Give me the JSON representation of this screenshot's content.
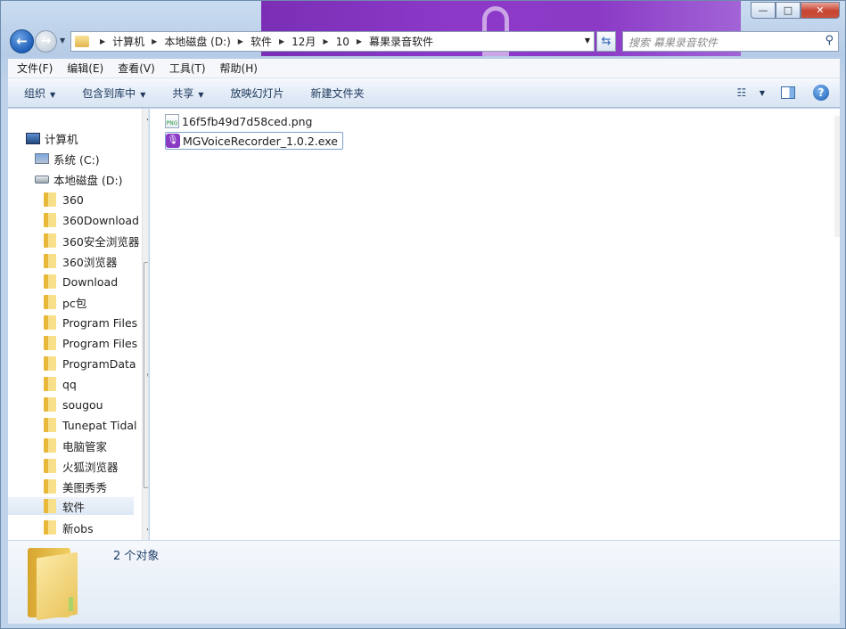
{
  "window": {
    "caption": {
      "minimize": "—",
      "maximize": "□",
      "close": "✕"
    }
  },
  "nav": {
    "back_glyph": "←",
    "forward_glyph": "→",
    "breadcrumbs": [
      "计算机",
      "本地磁盘 (D:)",
      "软件",
      "12月",
      "10",
      "幕果录音软件"
    ],
    "search_placeholder": "搜索 幕果录音软件"
  },
  "menubar": {
    "items": [
      "文件(F)",
      "编辑(E)",
      "查看(V)",
      "工具(T)",
      "帮助(H)"
    ]
  },
  "toolbar": {
    "organize": "组织",
    "include_in_library": "包含到库中",
    "share": "共享",
    "slideshow": "放映幻灯片",
    "new_folder": "新建文件夹"
  },
  "navpane": {
    "computer": "计算机",
    "drive_c": "系统 (C:)",
    "drive_d": "本地磁盘 (D:)",
    "folders": [
      "360",
      "360Download",
      "360安全浏览器",
      "360浏览器",
      "Download",
      "pc包",
      "Program Files",
      "Program Files",
      "ProgramData",
      "qq",
      "sougou",
      "Tunepat Tidal",
      "电脑管家",
      "火狐浏览器",
      "美图秀秀",
      "软件",
      "新obs"
    ],
    "selected_folder": "软件"
  },
  "files": [
    {
      "name": "16f5fb49d7d58ced.png",
      "type": "png",
      "selected": false
    },
    {
      "name": "MGVoiceRecorder_1.0.2.exe",
      "type": "exe",
      "selected": true
    }
  ],
  "details": {
    "count": "2 个对象"
  },
  "colors": {
    "title_art": "#8b3ac6",
    "accent": "#1f5fb8"
  }
}
